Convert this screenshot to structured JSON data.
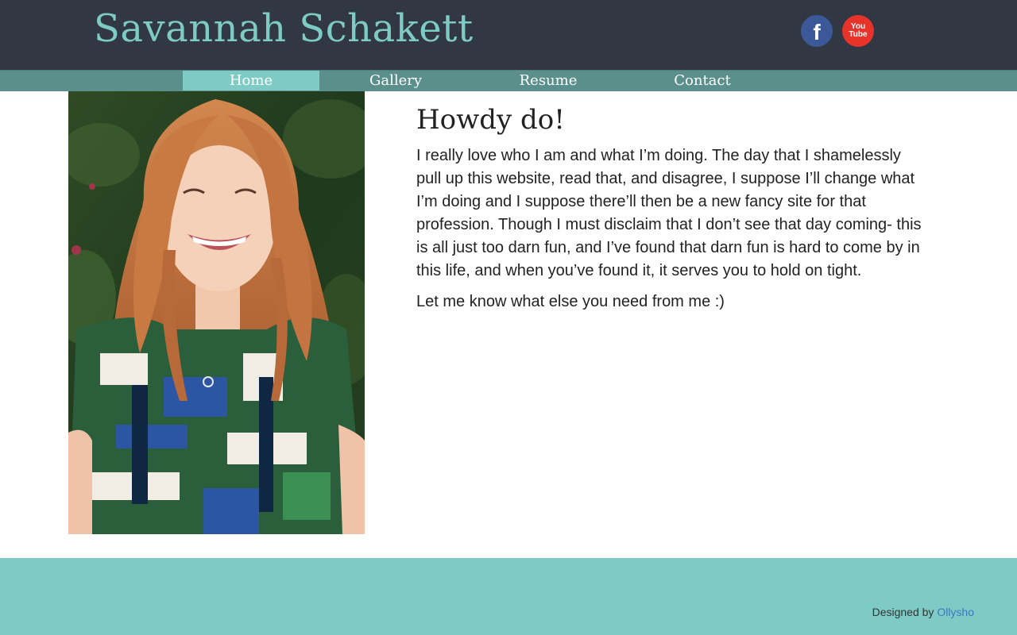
{
  "header": {
    "site_title": "Savannah Schakett",
    "social": [
      {
        "name": "facebook-icon",
        "glyph": "f"
      },
      {
        "name": "youtube-icon",
        "glyph_line1": "You",
        "glyph_line2": "Tube"
      }
    ]
  },
  "nav": {
    "items": [
      {
        "label": "Home",
        "active": true
      },
      {
        "label": "Gallery",
        "active": false
      },
      {
        "label": "Resume",
        "active": false
      },
      {
        "label": "Contact",
        "active": false
      }
    ]
  },
  "main": {
    "heading": "Howdy do!",
    "paragraph_1": "I really love who I am and what I’m doing. The day that I shamelessly pull up this website, read that, and disagree, I suppose I’ll change what I’m doing and I suppose there’ll then be a new fancy site for that profession. Though I must disclaim that I don’t see that day coming- this is all just too darn fun, and I’ve found that darn fun is hard to come by in this life, and when you’ve found it, it serves you to hold on tight.",
    "paragraph_2": "Let me know what else you need from me :)"
  },
  "footer": {
    "credit_prefix": "Designed by ",
    "credit_link": "Ollysho"
  },
  "colors": {
    "header_bg": "#323843",
    "accent": "#7ecbc5",
    "nav_bg": "#5b8f8b",
    "link": "#3a78c2"
  }
}
